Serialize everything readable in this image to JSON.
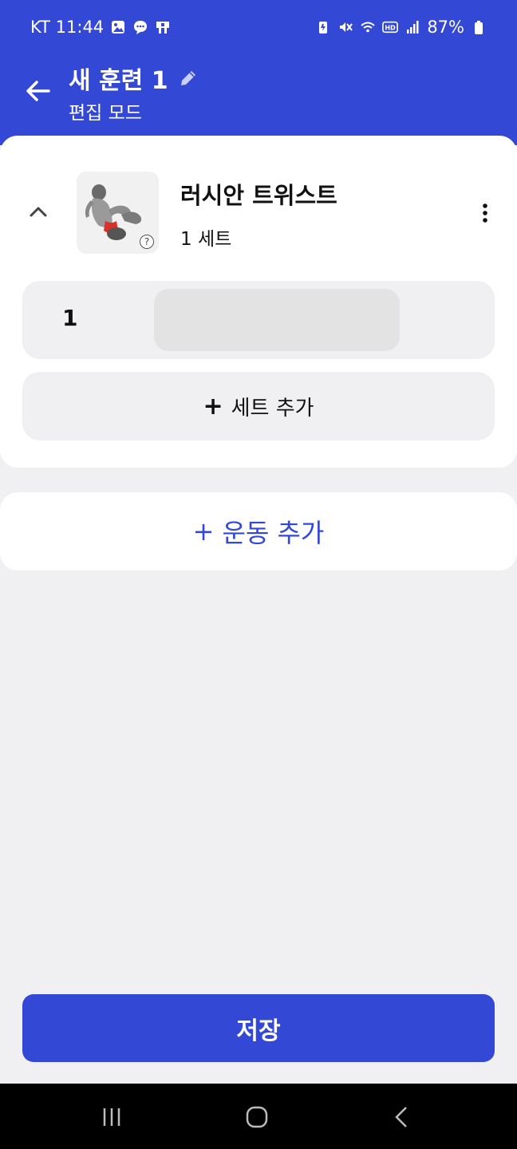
{
  "status": {
    "carrier_time": "KT 11:44",
    "battery": "87%"
  },
  "header": {
    "title": "새 훈련 1",
    "subtitle": "편집 모드"
  },
  "exercise": {
    "name": "러시안 트위스트",
    "sets_label": "1 세트",
    "help_glyph": "?",
    "sets": [
      {
        "number": "1",
        "value": ""
      }
    ]
  },
  "actions": {
    "add_set_plus": "+",
    "add_set_label": "세트 추가",
    "add_exercise_plus": "+",
    "add_exercise_label": "운동 추가",
    "save_label": "저장"
  },
  "colors": {
    "primary": "#3448d6",
    "background": "#f0f0f2",
    "card": "#ffffff",
    "input": "#e3e3e4"
  }
}
